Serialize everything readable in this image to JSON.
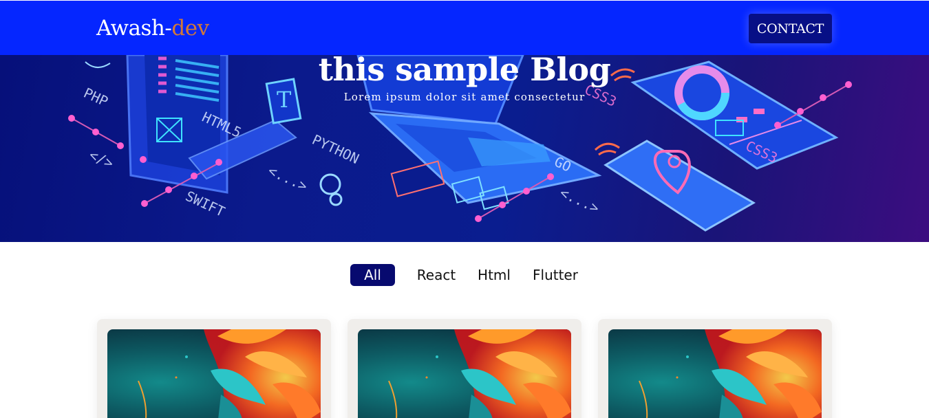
{
  "navbar": {
    "brand_main": "Awash-",
    "brand_accent": "dev",
    "contact_label": "CONTACT"
  },
  "hero": {
    "title": "this sample Blog",
    "subtitle": "Lorem ipsum dolor sit amet consectetur",
    "illustration_labels": [
      "PHP",
      "HTML5",
      "PYTHON",
      "SWIFT",
      "GO",
      "CSS3",
      "CSS3",
      "</>",
      "<...>",
      "<...>",
      "T"
    ]
  },
  "tabs": [
    {
      "label": "All",
      "active": true
    },
    {
      "label": "React",
      "active": false
    },
    {
      "label": "Html",
      "active": false
    },
    {
      "label": "Flutter",
      "active": false
    }
  ],
  "cards": [
    {
      "image": "abstract-flower-artwork"
    },
    {
      "image": "abstract-flower-artwork"
    },
    {
      "image": "abstract-flower-artwork"
    }
  ],
  "colors": {
    "navbar": "#0526ff",
    "brand_accent": "#d0793a",
    "contact_button": "#070f86",
    "active_tab": "#070a6f",
    "card_background": "#f0eeeb"
  }
}
